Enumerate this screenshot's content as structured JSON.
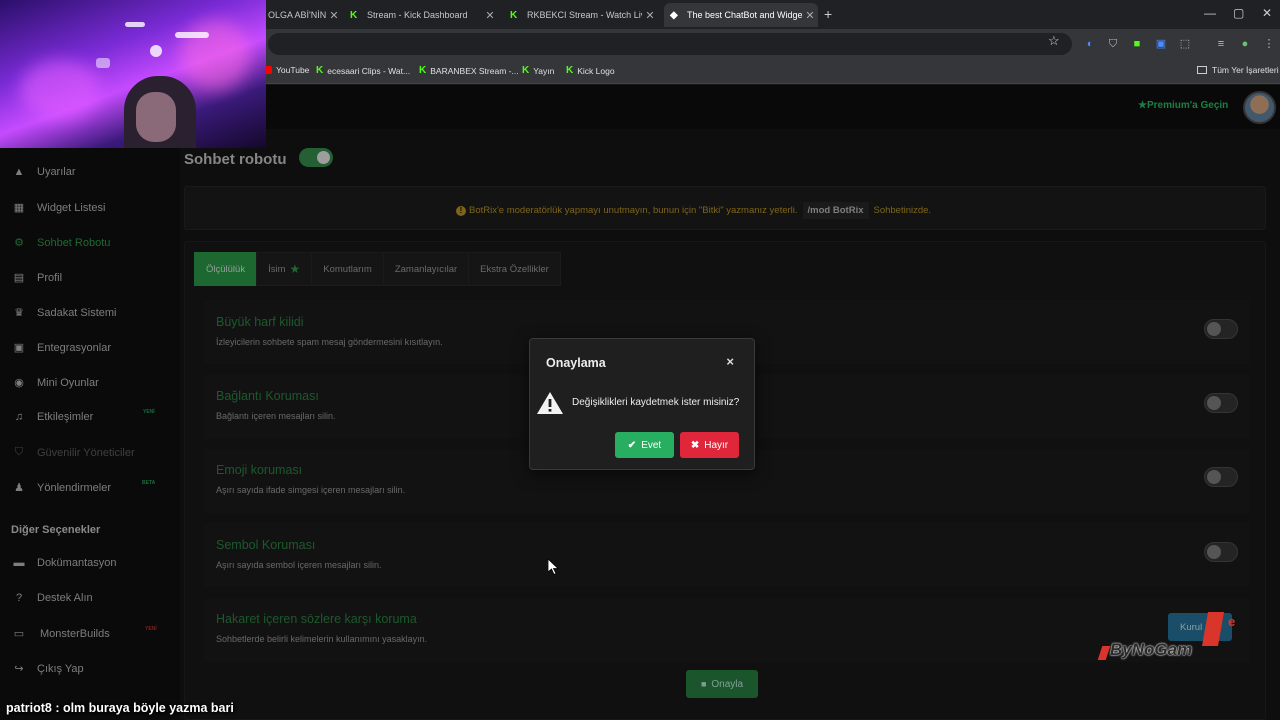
{
  "browser": {
    "tabs": [
      {
        "label": "OLGA ABİ'NİN \\",
        "active": false
      },
      {
        "label": "Stream - Kick Dashboard",
        "active": false
      },
      {
        "label": "RKBEKCI Stream - Watch Live o",
        "active": false
      },
      {
        "label": "The best ChatBot and Widgets",
        "active": true
      }
    ],
    "bookmarks": [
      "YouTube",
      "ecesaari Clips - Wat...",
      "BARANBEX Stream -...",
      "Yayın",
      "Kick Logo"
    ],
    "all_bookmarks": "Tüm Yer İşaretleri"
  },
  "header": {
    "premium_label": "Premium'a Geçin"
  },
  "sidebar": {
    "items": [
      {
        "label": "Uyarılar",
        "icon": "warning-icon"
      },
      {
        "label": "Widget Listesi",
        "icon": "grid-icon"
      },
      {
        "label": "Sohbet Robotu",
        "icon": "robot-icon"
      },
      {
        "label": "Profil",
        "icon": "id-card-icon"
      },
      {
        "label": "Sadakat Sistemi",
        "icon": "trophy-icon"
      },
      {
        "label": "Entegrasyonlar",
        "icon": "plug-icon"
      },
      {
        "label": "Mini Oyunlar",
        "icon": "gamepad-icon"
      },
      {
        "label": "Etkileşimler",
        "icon": "music-icon"
      },
      {
        "label": "Güvenilir Yöneticiler",
        "icon": "shield-icon"
      },
      {
        "label": "Yönlendirmeler",
        "icon": "users-icon"
      }
    ],
    "tags": {
      "interactions": "YENİ",
      "redirects": "BETA",
      "builds": "YENİ"
    },
    "other_title": "Diğer Seçenekler",
    "other_items": [
      {
        "label": "Dokümantasyon",
        "icon": "book-icon"
      },
      {
        "label": "Destek Alın",
        "icon": "question-icon"
      },
      {
        "label": "MonsterBuilds",
        "icon": "laptop-icon"
      },
      {
        "label": "Çıkış Yap",
        "icon": "logout-icon"
      }
    ]
  },
  "page": {
    "title": "Sohbet robotu",
    "alert_before": "BotRix'e moderatörlük yapmayı unutmayın, bunun için \"Bitki\" yazmanız yeterli.",
    "alert_code": "/mod BotRix",
    "alert_after": "Sohbetinizde.",
    "tabs": [
      "Ölçülülük",
      "İsim",
      "Komutlarım",
      "Zamanlayıcılar",
      "Ekstra Özellikler"
    ],
    "rows": [
      {
        "title": "Büyük harf kilidi",
        "desc": "İzleyicilerin sohbete spam mesaj göndermesini kısıtlayın."
      },
      {
        "title": "Bağlantı Koruması",
        "desc": "Bağlantı içeren mesajları silin."
      },
      {
        "title": "Emoji koruması",
        "desc": "Aşırı sayıda ifade simgesi içeren mesajları silin."
      },
      {
        "title": "Sembol Koruması",
        "desc": "Aşırı sayıda sembol içeren mesajları silin."
      },
      {
        "title": "Hakaret içeren sözlere karşı koruma",
        "desc": "Sohbetlerde belirli kelimelerin kullanımını yasaklayın."
      }
    ],
    "configure_label": "Kurul",
    "confirm_label": "Onayla"
  },
  "modal": {
    "title": "Onaylama",
    "close": "×",
    "message": "Değişiklikleri kaydetmek ister misiniz?",
    "yes": "Evet",
    "no": "Hayır"
  },
  "stream": {
    "chat_user": "patriot8",
    "chat_message": " : olm buraya böyle yazma bari",
    "watermark": "ByNoGam",
    "watermark_sup": "e"
  },
  "colors": {
    "accent_green": "#2fa84f",
    "danger_red": "#e0263a",
    "warning_yellow": "#c9a227",
    "info_blue": "#2a7fa8"
  }
}
